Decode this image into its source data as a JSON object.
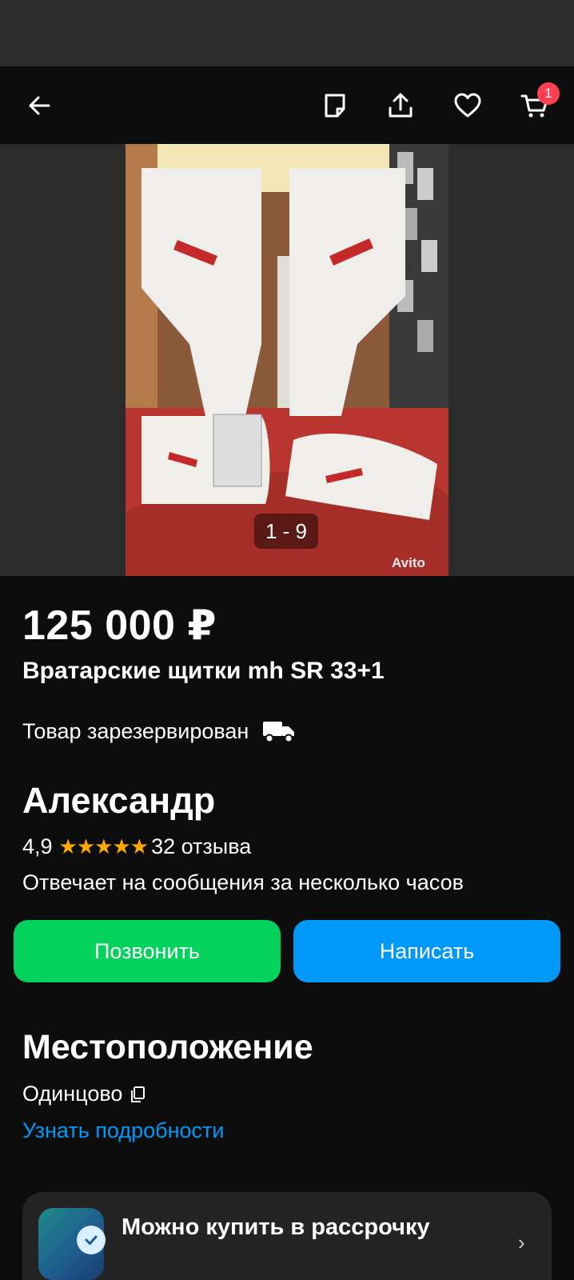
{
  "nav": {
    "badge_count": "1"
  },
  "gallery": {
    "counter": "1 - 9",
    "watermark": "Avito"
  },
  "listing": {
    "price": "125 000 ₽",
    "title": "Вратарские щитки mh SR 33+1",
    "status": "Товар зарезервирован"
  },
  "seller": {
    "name": "Александр",
    "rating": "4,9",
    "stars": 5,
    "reviews": "32 отзыва",
    "response_time": "Отвечает на сообщения за несколько часов"
  },
  "actions": {
    "call_label": "Позвонить",
    "write_label": "Написать"
  },
  "location": {
    "heading": "Местоположение",
    "city": "Одинцово",
    "details_link": "Узнать подробности"
  },
  "installment": {
    "title": "Можно купить в рассрочку"
  },
  "colors": {
    "call_button": "#02d15c",
    "write_button": "#0099f7",
    "stars": "#ffa800",
    "badge": "#ff4053"
  }
}
